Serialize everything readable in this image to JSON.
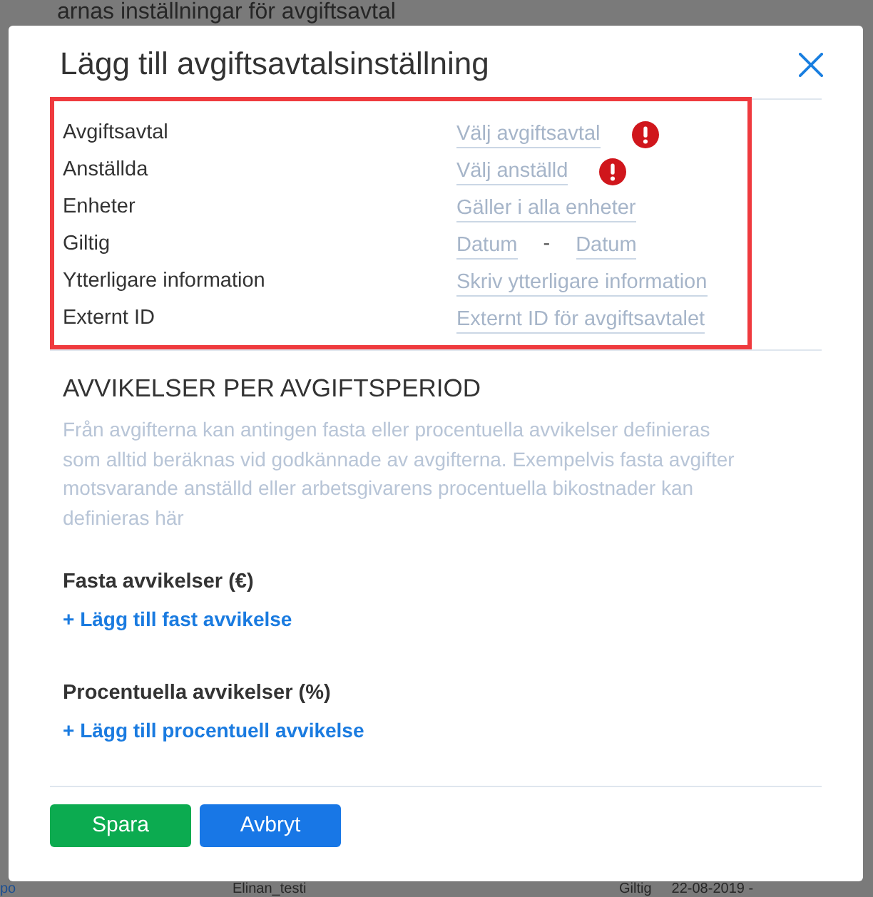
{
  "background_page": {
    "heading": "arnas inställningar för avgiftsavtal",
    "bottom_row": {
      "link": "po",
      "name": "Elinan_testi",
      "label": "Giltig",
      "date": "22-08-2019 -"
    }
  },
  "dialog": {
    "title": "Lägg till avgiftsavtalsinställning",
    "form": {
      "highlighted": true,
      "fields": [
        {
          "kind": "text",
          "label": "Avgiftsavtal",
          "placeholder": "Välj avgiftsavtal",
          "invalid": true
        },
        {
          "kind": "text",
          "label": "Anställda",
          "placeholder": "Välj anställd",
          "invalid": true
        },
        {
          "kind": "text",
          "label": "Enheter",
          "placeholder": "Gäller i alla enheter",
          "invalid": false
        },
        {
          "kind": "date_range",
          "label": "Giltig",
          "from": {
            "placeholder": "Datum"
          },
          "separator": "-",
          "to": {
            "placeholder": "Datum"
          },
          "invalid": false
        },
        {
          "kind": "text",
          "label": "Ytterligare information",
          "placeholder": "Skriv ytterligare information",
          "invalid": false
        },
        {
          "kind": "text",
          "label": "Externt ID",
          "placeholder": "Externt ID för avgiftsavtalet",
          "invalid": false
        }
      ]
    },
    "deviations": {
      "heading": "AVVIKELSER PER AVGIFTSPERIOD",
      "description": "Från avgifterna kan antingen fasta eller procentuella avvikelser definieras som alltid beräknas vid godkännade av avgifterna. Exempelvis fasta avgifter motsvarande anställd eller arbetsgivarens procentuella bikostnader kan definieras här",
      "groups": [
        {
          "title": "Fasta avvikelser (€)",
          "add_link": "+ Lägg till fast avvikelse"
        },
        {
          "title": "Procentuella avvikelser (%)",
          "add_link": "+ Lägg till procentuell avvikelse"
        }
      ]
    },
    "buttons": [
      {
        "kind": "confirm",
        "label": "Spara"
      },
      {
        "kind": "cancel",
        "label": "Avbryt"
      }
    ]
  }
}
